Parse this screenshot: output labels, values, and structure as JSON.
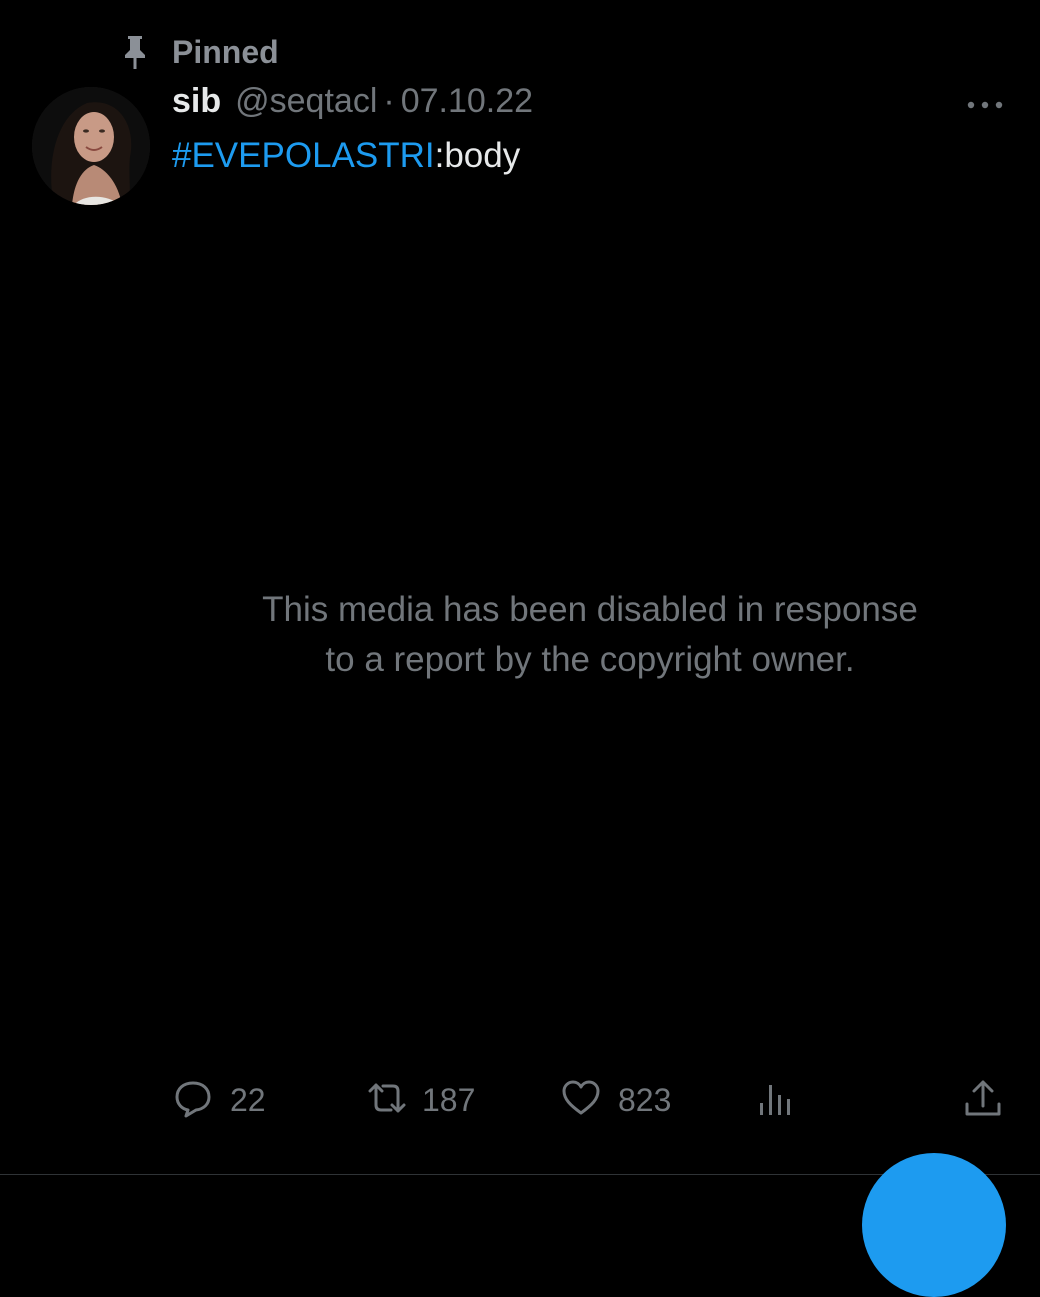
{
  "pinned": {
    "label": "Pinned",
    "icon": "pin-icon"
  },
  "tweet": {
    "author": {
      "display_name": "sib",
      "handle": "@seqtacl",
      "avatar_icon": "avatar-photo"
    },
    "separator": "·",
    "date": "07.10.22",
    "more_icon": "more-icon",
    "text": {
      "hashtag": "#EVEPOLASTRI",
      "rest": ":body"
    },
    "media": {
      "message_line1": "This media has been disabled in response",
      "message_line2": "to a report by the copyright owner."
    },
    "actions": {
      "replies": {
        "icon": "reply-icon",
        "count": "22"
      },
      "retweets": {
        "icon": "retweet-icon",
        "count": "187"
      },
      "likes": {
        "icon": "heart-icon",
        "count": "823"
      },
      "views": {
        "icon": "analytics-icon"
      },
      "share": {
        "icon": "share-icon"
      }
    }
  },
  "fab": {
    "icon": "compose-icon"
  },
  "colors": {
    "background": "#000000",
    "accent": "#1d9bf0",
    "secondary_text": "#71767b",
    "primary_text": "#e7e9ea"
  }
}
